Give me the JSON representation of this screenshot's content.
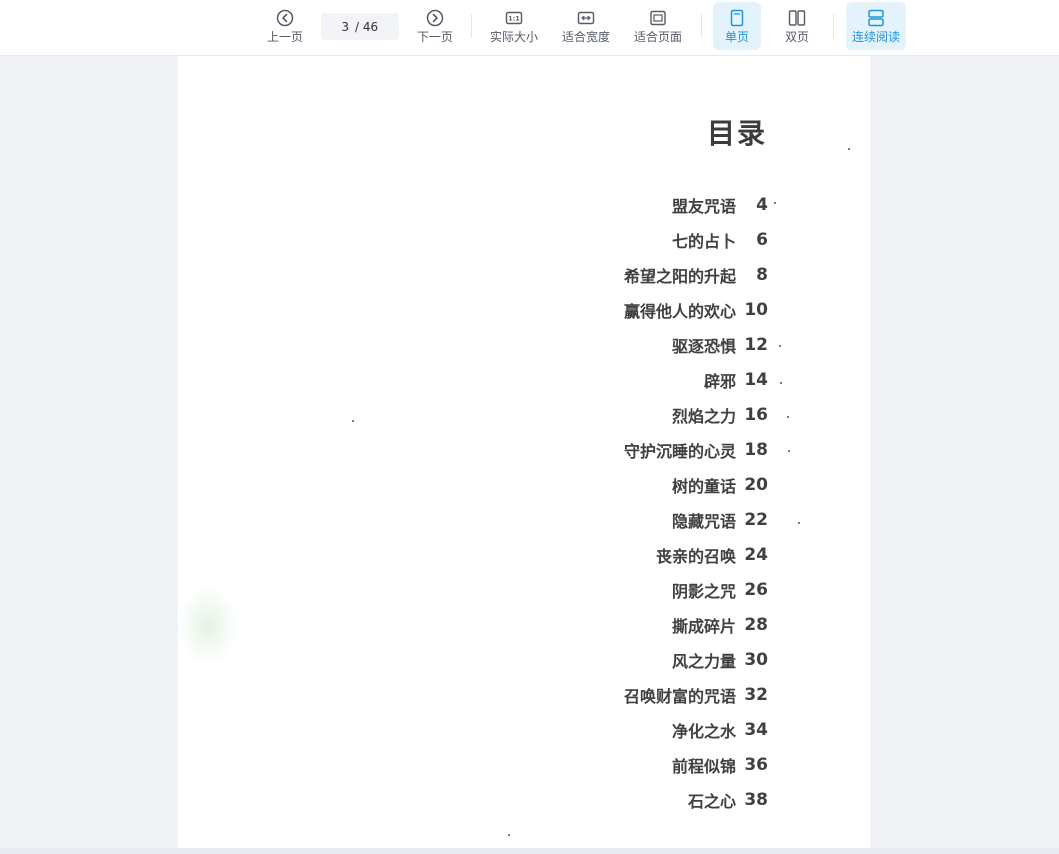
{
  "toolbar": {
    "prev_label": "上一页",
    "current_page": "3",
    "total_pages": "/ 46",
    "next_label": "下一页",
    "actual_size_label": "实际大小",
    "fit_width_label": "适合宽度",
    "fit_page_label": "适合页面",
    "single_page_label": "单页",
    "double_page_label": "双页",
    "continuous_label": "连续阅读"
  },
  "colors": {
    "accent": "#1f97d6",
    "active_bg": "#e3f2fb",
    "toolbar_text": "#555a66",
    "page_bg": "#f2f3f7"
  },
  "icons": {
    "prev": "circle-chevron-left-icon",
    "next": "circle-chevron-right-icon",
    "actual_size": "one-to-one-icon",
    "fit_width": "fit-width-arrows-icon",
    "fit_page": "fit-page-icon",
    "single_page": "single-page-icon",
    "double_page": "double-page-icon",
    "continuous": "continuous-scroll-icon"
  },
  "document": {
    "title": "目录",
    "toc": [
      {
        "title": "盟友咒语",
        "page": "4"
      },
      {
        "title": "七的占卜",
        "page": "6"
      },
      {
        "title": "希望之阳的升起",
        "page": "8"
      },
      {
        "title": "赢得他人的欢心",
        "page": "10"
      },
      {
        "title": "驱逐恐惧",
        "page": "12"
      },
      {
        "title": "辟邪",
        "page": "14"
      },
      {
        "title": "烈焰之力",
        "page": "16"
      },
      {
        "title": "守护沉睡的心灵",
        "page": "18"
      },
      {
        "title": "树的童话",
        "page": "20"
      },
      {
        "title": "隐藏咒语",
        "page": "22"
      },
      {
        "title": "丧亲的召唤",
        "page": "24"
      },
      {
        "title": "阴影之咒",
        "page": "26"
      },
      {
        "title": "撕成碎片",
        "page": "28"
      },
      {
        "title": "风之力量",
        "page": "30"
      },
      {
        "title": "召唤财富的咒语",
        "page": "32"
      },
      {
        "title": "净化之水",
        "page": "34"
      },
      {
        "title": "前程似锦",
        "page": "36"
      },
      {
        "title": "石之心",
        "page": "38"
      }
    ]
  }
}
